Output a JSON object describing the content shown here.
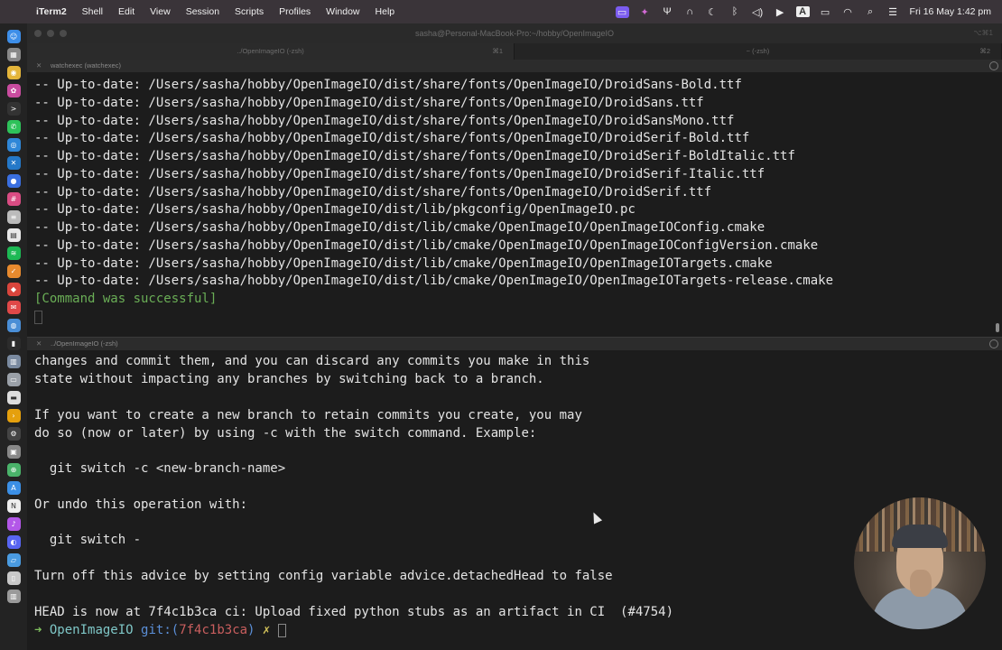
{
  "menubar": {
    "app_name": "iTerm2",
    "menus": [
      "Shell",
      "Edit",
      "View",
      "Session",
      "Scripts",
      "Profiles",
      "Window",
      "Help"
    ],
    "status_icons": [
      "screen-record-icon",
      "color-picker-icon",
      "fork-icon",
      "headset-icon",
      "moon-icon",
      "bluetooth-icon",
      "volume-icon",
      "play-icon",
      "input-source-icon",
      "battery-icon",
      "wifi-icon",
      "search-icon",
      "control-center-icon"
    ],
    "input_source": "A",
    "datetime": "Fri 16 May  1:42 pm"
  },
  "window": {
    "title": "sasha@Personal-MacBook-Pro:~/hobby/OpenImageIO",
    "corner_text": "⌥⌘1",
    "tabs": [
      {
        "label": "../OpenImageIO (-zsh)",
        "shortcut": "⌘1",
        "active": true
      },
      {
        "label": "~ (-zsh)",
        "shortcut": "⌘2",
        "active": false
      }
    ]
  },
  "pane_top": {
    "header": "watchexec (watchexec)",
    "lines": [
      "-- Up-to-date: /Users/sasha/hobby/OpenImageIO/dist/share/fonts/OpenImageIO/DroidSans-Bold.ttf",
      "-- Up-to-date: /Users/sasha/hobby/OpenImageIO/dist/share/fonts/OpenImageIO/DroidSans.ttf",
      "-- Up-to-date: /Users/sasha/hobby/OpenImageIO/dist/share/fonts/OpenImageIO/DroidSansMono.ttf",
      "-- Up-to-date: /Users/sasha/hobby/OpenImageIO/dist/share/fonts/OpenImageIO/DroidSerif-Bold.ttf",
      "-- Up-to-date: /Users/sasha/hobby/OpenImageIO/dist/share/fonts/OpenImageIO/DroidSerif-BoldItalic.ttf",
      "-- Up-to-date: /Users/sasha/hobby/OpenImageIO/dist/share/fonts/OpenImageIO/DroidSerif-Italic.ttf",
      "-- Up-to-date: /Users/sasha/hobby/OpenImageIO/dist/share/fonts/OpenImageIO/DroidSerif.ttf",
      "-- Up-to-date: /Users/sasha/hobby/OpenImageIO/dist/lib/pkgconfig/OpenImageIO.pc",
      "-- Up-to-date: /Users/sasha/hobby/OpenImageIO/dist/lib/cmake/OpenImageIO/OpenImageIOConfig.cmake",
      "-- Up-to-date: /Users/sasha/hobby/OpenImageIO/dist/lib/cmake/OpenImageIO/OpenImageIOConfigVersion.cmake",
      "-- Up-to-date: /Users/sasha/hobby/OpenImageIO/dist/lib/cmake/OpenImageIO/OpenImageIOTargets.cmake",
      "-- Up-to-date: /Users/sasha/hobby/OpenImageIO/dist/lib/cmake/OpenImageIO/OpenImageIOTargets-release.cmake"
    ],
    "status": "[Command was successful]"
  },
  "pane_bottom": {
    "header": "../OpenImageIO (-zsh)",
    "lines": [
      "changes and commit them, and you can discard any commits you make in this",
      "state without impacting any branches by switching back to a branch.",
      "",
      "If you want to create a new branch to retain commits you create, you may",
      "do so (now or later) by using -c with the switch command. Example:",
      "",
      "  git switch -c <new-branch-name>",
      "",
      "Or undo this operation with:",
      "",
      "  git switch -",
      "",
      "Turn off this advice by setting config variable advice.detachedHead to false",
      "",
      "HEAD is now at 7f4c1b3ca ci: Upload fixed python stubs as an artifact in CI  (#4754)"
    ],
    "prompt": {
      "arrow": "➜",
      "dir": "OpenImageIO",
      "git_prefix": "git:(",
      "branch": "7f4c1b3ca",
      "git_suffix": ")",
      "dirty": "✗"
    }
  },
  "dock": {
    "apps": [
      {
        "name": "finder",
        "color": "#3d8ee8",
        "glyph": "☺"
      },
      {
        "name": "launchpad",
        "color": "#888888",
        "glyph": "▦"
      },
      {
        "name": "chrome",
        "color": "#e4b53a",
        "glyph": "◉"
      },
      {
        "name": "photos",
        "color": "#c94c9f",
        "glyph": "✿"
      },
      {
        "name": "terminal",
        "color": "#333333",
        "glyph": ">"
      },
      {
        "name": "whatsapp",
        "color": "#2ec25a",
        "glyph": "✆"
      },
      {
        "name": "safari",
        "color": "#2f87d8",
        "glyph": "◎"
      },
      {
        "name": "vscode",
        "color": "#2478c8",
        "glyph": "✕"
      },
      {
        "name": "signal",
        "color": "#3a6fe0",
        "glyph": "●"
      },
      {
        "name": "slack",
        "color": "#d94c83",
        "glyph": "#"
      },
      {
        "name": "notes",
        "color": "#bbbbbb",
        "glyph": "≡"
      },
      {
        "name": "calendar",
        "color": "#e9e9e9",
        "glyph": "▤"
      },
      {
        "name": "spotify",
        "color": "#1db954",
        "glyph": "≋"
      },
      {
        "name": "reminders",
        "color": "#e88a2e",
        "glyph": "✓"
      },
      {
        "name": "todoist",
        "color": "#d9453c",
        "glyph": "◆"
      },
      {
        "name": "mail",
        "color": "#e04848",
        "glyph": "✉"
      },
      {
        "name": "network",
        "color": "#4a8ed6",
        "glyph": "◍"
      },
      {
        "name": "console",
        "color": "#2c2c2c",
        "glyph": "▮"
      },
      {
        "name": "preview",
        "color": "#7a8aa0",
        "glyph": "▥"
      },
      {
        "name": "files",
        "color": "#9aa0a8",
        "glyph": "▭"
      },
      {
        "name": "drive",
        "color": "#dddddd",
        "glyph": "▬"
      },
      {
        "name": "plex",
        "color": "#e5a00d",
        "glyph": "›"
      },
      {
        "name": "github",
        "color": "#444444",
        "glyph": "⚙"
      },
      {
        "name": "printer",
        "color": "#888888",
        "glyph": "▣"
      },
      {
        "name": "maps",
        "color": "#4ab36a",
        "glyph": "⊕"
      },
      {
        "name": "appstore",
        "color": "#3b8fe5",
        "glyph": "A"
      },
      {
        "name": "notion",
        "color": "#eeeeee",
        "glyph": "N"
      },
      {
        "name": "music",
        "color": "#b357e8",
        "glyph": "♪"
      },
      {
        "name": "discord",
        "color": "#5865f2",
        "glyph": "◐"
      },
      {
        "name": "folder",
        "color": "#4a9be0",
        "glyph": "▱"
      },
      {
        "name": "documents",
        "color": "#c8c8c8",
        "glyph": "▯"
      },
      {
        "name": "trash",
        "color": "#9a9a9a",
        "glyph": "▥"
      }
    ]
  }
}
